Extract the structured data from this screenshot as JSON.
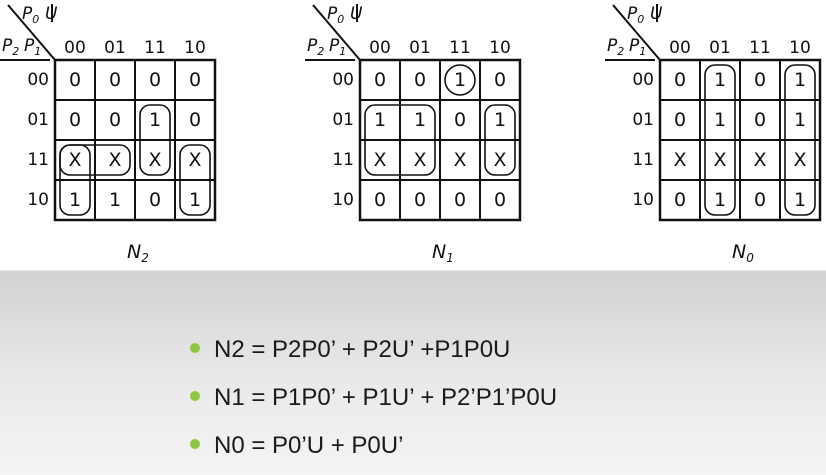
{
  "colors": {
    "bullet": "#8dc63f",
    "grid": "#111111",
    "panel": "#ffffff"
  },
  "kmaps": [
    {
      "name": "N",
      "subscript": "2",
      "row_var": "P",
      "row_var_subs": [
        "2",
        "1"
      ],
      "col_var_subs": [
        "0",
        ""
      ],
      "col_var": "P",
      "col_var_tail": "U",
      "col_labels": [
        "00",
        "01",
        "11",
        "10"
      ],
      "row_labels": [
        "00",
        "01",
        "11",
        "10"
      ],
      "cells": [
        [
          "0",
          "0",
          "0",
          "0"
        ],
        [
          "0",
          "0",
          "1",
          "0"
        ],
        [
          "X",
          "X",
          "X",
          "X"
        ],
        [
          "1",
          "1",
          "0",
          "1"
        ]
      ]
    },
    {
      "name": "N",
      "subscript": "1",
      "row_var": "P",
      "row_var_subs": [
        "2",
        "1"
      ],
      "col_var_subs": [
        "0",
        ""
      ],
      "col_var": "P",
      "col_var_tail": "U",
      "col_labels": [
        "00",
        "01",
        "11",
        "10"
      ],
      "row_labels": [
        "00",
        "01",
        "11",
        "10"
      ],
      "cells": [
        [
          "0",
          "0",
          "1",
          "0"
        ],
        [
          "1",
          "1",
          "0",
          "1"
        ],
        [
          "X",
          "X",
          "X",
          "X"
        ],
        [
          "0",
          "0",
          "0",
          "0"
        ]
      ]
    },
    {
      "name": "N",
      "subscript": "0",
      "row_var": "P",
      "row_var_subs": [
        "2",
        "1"
      ],
      "col_var_subs": [
        "0",
        ""
      ],
      "col_var": "P",
      "col_var_tail": "U",
      "col_labels": [
        "00",
        "01",
        "11",
        "10"
      ],
      "row_labels": [
        "00",
        "01",
        "11",
        "10"
      ],
      "cells": [
        [
          "0",
          "1",
          "0",
          "1"
        ],
        [
          "0",
          "1",
          "0",
          "1"
        ],
        [
          "X",
          "X",
          "X",
          "X"
        ],
        [
          "0",
          "1",
          "0",
          "1"
        ]
      ]
    }
  ],
  "equations": [
    "N2 = P2P0’ + P2U’ +P1P0U",
    "N1 = P1P0’ + P1U’ + P2’P1’P0U",
    "N0 = P0’U + P0U’"
  ]
}
